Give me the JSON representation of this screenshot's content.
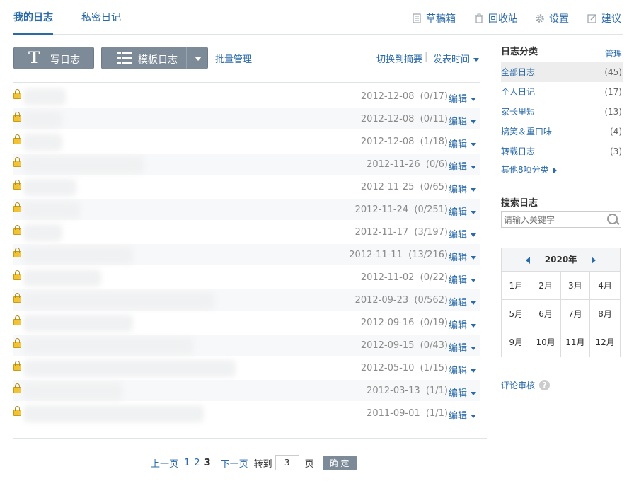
{
  "header": {
    "tab_active": "我的日志",
    "tab_private": "私密日记",
    "links": [
      {
        "label": "草稿箱",
        "icon": "draft-icon"
      },
      {
        "label": "回收站",
        "icon": "trash-icon"
      },
      {
        "label": "设置",
        "icon": "gear-icon"
      },
      {
        "label": "建议",
        "icon": "edit-icon"
      }
    ]
  },
  "toolbar": {
    "write_label": "写日志",
    "template_label": "模板日志",
    "batch_label": "批量管理",
    "switch_label": "切换到摘要",
    "separator": "|",
    "sort_label": "发表时间"
  },
  "entries": [
    {
      "date": "2012-12-08",
      "counts": "(0/17)",
      "edit": "编辑",
      "title_width": 60
    },
    {
      "date": "2012-12-08",
      "counts": "(0/11)",
      "edit": "编辑",
      "title_width": 55
    },
    {
      "date": "2012-12-08",
      "counts": "(1/18)",
      "edit": "编辑",
      "title_width": 55
    },
    {
      "date": "2012-11-26",
      "counts": "(0/6)",
      "edit": "编辑",
      "title_width": 170
    },
    {
      "date": "2012-11-25",
      "counts": "(0/65)",
      "edit": "编辑",
      "title_width": 75
    },
    {
      "date": "2012-11-24",
      "counts": "(0/251)",
      "edit": "编辑",
      "title_width": 80
    },
    {
      "date": "2012-11-17",
      "counts": "(3/197)",
      "edit": "编辑",
      "title_width": 55
    },
    {
      "date": "2012-11-11",
      "counts": "(13/216)",
      "edit": "编辑",
      "title_width": 155
    },
    {
      "date": "2012-11-02",
      "counts": "(0/22)",
      "edit": "编辑",
      "title_width": 110
    },
    {
      "date": "2012-09-23",
      "counts": "(0/562)",
      "edit": "编辑",
      "title_width": 270
    },
    {
      "date": "2012-09-16",
      "counts": "(0/19)",
      "edit": "编辑",
      "title_width": 155
    },
    {
      "date": "2012-09-15",
      "counts": "(0/43)",
      "edit": "编辑",
      "title_width": 240
    },
    {
      "date": "2012-05-10",
      "counts": "(1/15)",
      "edit": "编辑",
      "title_width": 300
    },
    {
      "date": "2012-03-13",
      "counts": "(1/1)",
      "edit": "编辑",
      "title_width": 140
    },
    {
      "date": "2011-09-01",
      "counts": "(1/1)",
      "edit": "编辑",
      "title_width": 255
    }
  ],
  "pager": {
    "prev": "上一页",
    "pages": [
      "1",
      "2"
    ],
    "current": "3",
    "next": "下一页",
    "goto": "转到",
    "goto_value": "3",
    "page_unit": "页",
    "confirm": "确 定"
  },
  "sidebar": {
    "categories_title": "日志分类",
    "manage": "管理",
    "categories": [
      {
        "label": "全部日志",
        "count": "(45)",
        "active": true
      },
      {
        "label": "个人日记",
        "count": "(17)"
      },
      {
        "label": "家长里短",
        "count": "(13)"
      },
      {
        "label": "搞笑＆重口味",
        "count": "(4)"
      },
      {
        "label": "转载日志",
        "count": "(3)"
      }
    ],
    "more_categories": "其他8项分类",
    "search_title": "搜索日志",
    "search_placeholder": "请输入关键字",
    "calendar_year": "2020年",
    "months": [
      "1月",
      "2月",
      "3月",
      "4月",
      "5月",
      "6月",
      "7月",
      "8月",
      "9月",
      "10月",
      "11月",
      "12月"
    ],
    "review_label": "评论审核",
    "review_help": "?"
  },
  "colors": {
    "accent": "#2a6aa8",
    "button": "#7d8b99",
    "lock": "#f1c232"
  }
}
